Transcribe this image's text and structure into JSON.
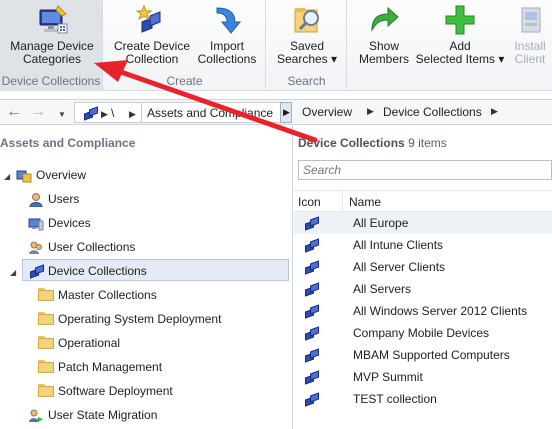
{
  "ribbon": {
    "groups": [
      {
        "label": "Device Collections",
        "buttons": [
          {
            "label": "Manage Device Categories",
            "line1": "Manage Device",
            "line2": "Categories"
          }
        ]
      },
      {
        "label": "Create",
        "buttons": [
          {
            "label": "Create Device Collection",
            "line1": "Create Device",
            "line2": "Collection"
          },
          {
            "label": "Import Collections",
            "line1": "Import",
            "line2": "Collections"
          }
        ]
      },
      {
        "label": "Search",
        "buttons": [
          {
            "label": "Saved Searches",
            "line1": "Saved",
            "line2": "Searches ▾"
          }
        ]
      },
      {
        "label": "",
        "buttons": [
          {
            "label": "Show Members",
            "line1": "Show",
            "line2": "Members"
          },
          {
            "label": "Add Selected Items",
            "line1": "Add",
            "line2": "Selected Items ▾"
          },
          {
            "label": "Install Client",
            "line1": "Install",
            "line2": "Client"
          }
        ]
      }
    ]
  },
  "nav": {
    "root": "\\",
    "crumbs": [
      "Assets and Compliance",
      "Overview",
      "Device Collections"
    ]
  },
  "left_pane": {
    "header": "Assets and Compliance",
    "tree": [
      {
        "label": "Overview",
        "icon": "overview-icon"
      },
      {
        "label": "Users",
        "icon": "user-icon"
      },
      {
        "label": "Devices",
        "icon": "devices-icon"
      },
      {
        "label": "User Collections",
        "icon": "user-collections-icon"
      },
      {
        "label": "Device Collections",
        "icon": "device-collections-icon"
      },
      {
        "label": "Master Collections",
        "icon": "folder-icon"
      },
      {
        "label": "Operating System Deployment",
        "icon": "folder-icon"
      },
      {
        "label": "Operational",
        "icon": "folder-icon"
      },
      {
        "label": "Patch Management",
        "icon": "folder-icon"
      },
      {
        "label": "Software Deployment",
        "icon": "folder-icon"
      },
      {
        "label": "User State Migration",
        "icon": "user-state-migration-icon"
      }
    ]
  },
  "right_pane": {
    "title": "Device Collections",
    "count": "9 items",
    "search_placeholder": "Search",
    "columns": [
      "Icon",
      "Name"
    ],
    "rows": [
      "All Europe",
      "All Intune Clients",
      "All Server Clients",
      "All Servers",
      "All Windows Server 2012 Clients",
      "Company Mobile Devices",
      "MBAM Supported Computers",
      "MVP Summit",
      "TEST collection"
    ]
  },
  "colors": {
    "arrow": "#e8232a",
    "selection": "#e4ebf5",
    "accent": "#2f4cb8"
  }
}
